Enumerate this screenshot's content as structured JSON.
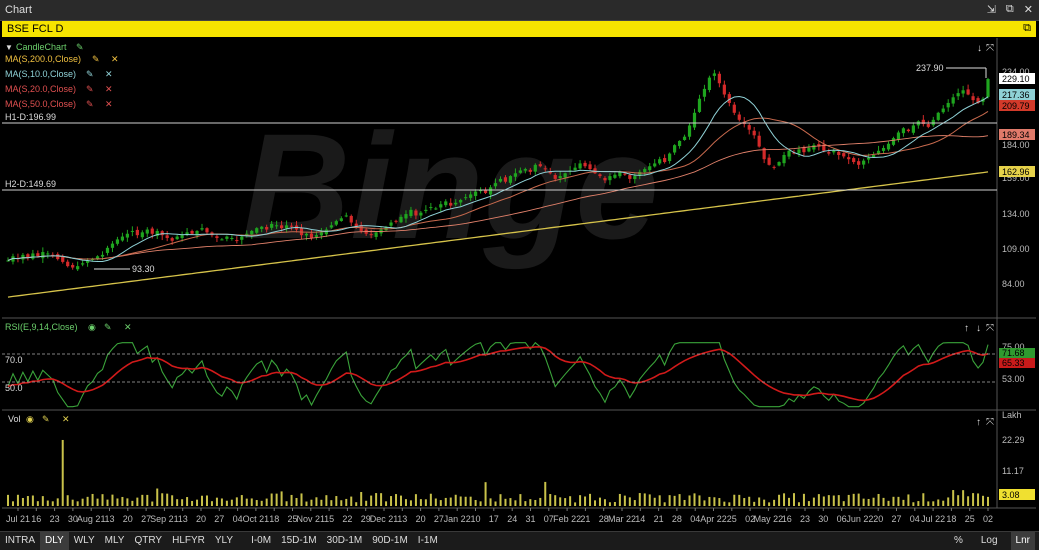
{
  "window": {
    "title": "Chart",
    "controls": [
      "⇲",
      "⧉",
      "✕"
    ]
  },
  "symbol_bar": {
    "label": "BSE FCL D",
    "restore_icon": "⧉"
  },
  "legend": {
    "candle": "CandleChart",
    "ma200": "MA(S,200.0,Close)",
    "ma10": "MA(S,10.0,Close)",
    "ma20": "MA(S,20.0,Close)",
    "ma50": "MA(S,50.0,Close)",
    "rsi": "RSI(E,9,14,Close)",
    "vol": "Vol"
  },
  "colors": {
    "bull": "#1fa51f",
    "bear": "#d42a2a",
    "ma200": "#d6c34a",
    "ma10": "#8fd1d6",
    "ma20": "#c96a4e",
    "ma50": "#e0806a",
    "rsi": "#3aa33a",
    "rsi_signal": "#d11a1a",
    "vol": "#c9c24a",
    "hline": "#d0d0d0"
  },
  "chart_data": [
    {
      "type": "candlestick",
      "title": "BSE FCL D",
      "x_labels": [
        "Jul 21",
        "16",
        "23",
        "30",
        "Aug 21",
        "13",
        "20",
        "27",
        "Sep 21",
        "13",
        "20",
        "27",
        "04",
        "Oct 21",
        "18",
        "25",
        "Nov 21",
        "15",
        "22",
        "29",
        "Dec 21",
        "13",
        "20",
        "27",
        "Jan 22",
        "10",
        "17",
        "24",
        "31",
        "07",
        "Feb 22",
        "21",
        "28",
        "Mar 22",
        "14",
        "21",
        "28",
        "04",
        "Apr 22",
        "25",
        "02",
        "May 22",
        "16",
        "23",
        "30",
        "06",
        "Jun 22",
        "20",
        "27",
        "04",
        "Jul 22",
        "18",
        "25",
        "02"
      ],
      "y_ticks": [
        84.0,
        109.0,
        134.0,
        159.0,
        184.0,
        234.0
      ],
      "ylim": [
        70,
        245
      ],
      "closes": [
        100,
        103,
        101,
        104,
        102,
        105,
        103,
        106,
        105,
        104,
        101,
        99,
        96,
        95,
        96,
        98,
        100,
        101,
        103,
        104,
        109,
        112,
        115,
        117,
        119,
        121,
        118,
        120,
        122,
        119,
        121,
        118,
        116,
        114,
        117,
        118,
        120,
        119,
        121,
        123,
        120,
        118,
        116,
        115,
        117,
        116,
        114,
        117,
        119,
        121,
        123,
        124,
        122,
        126,
        125,
        123,
        125,
        124,
        122,
        118,
        119,
        116,
        118,
        120,
        122,
        125,
        128,
        130,
        132,
        127,
        124,
        121,
        119,
        118,
        120,
        122,
        124,
        127,
        128,
        131,
        133,
        136,
        132,
        134,
        136,
        138,
        137,
        140,
        142,
        139,
        141,
        143,
        145,
        147,
        149,
        150,
        148,
        152,
        155,
        158,
        156,
        160,
        162,
        164,
        165,
        163,
        168,
        167,
        165,
        162,
        158,
        160,
        162,
        164,
        166,
        169,
        167,
        165,
        162,
        160,
        157,
        160,
        161,
        163,
        161,
        158,
        160,
        163,
        165,
        167,
        169,
        172,
        170,
        176,
        182,
        185,
        188,
        196,
        205,
        215,
        222,
        230,
        233,
        226,
        218,
        212,
        205,
        200,
        197,
        193,
        189,
        181,
        172,
        168,
        166,
        170,
        175,
        178,
        176,
        179,
        177,
        180,
        182,
        181,
        178,
        176,
        178,
        175,
        174,
        172,
        170,
        168,
        171,
        173,
        175,
        178,
        180,
        183,
        187,
        191,
        194,
        192,
        196,
        199,
        197,
        195,
        200,
        205,
        208,
        212,
        216,
        219,
        221,
        218,
        214,
        212,
        215,
        229
      ],
      "series": [
        {
          "name": "MA(S,10.0,Close)",
          "value_last": 217.36
        },
        {
          "name": "MA(S,20.0,Close)",
          "value_last": 209.79
        },
        {
          "name": "MA(S,50.0,Close)",
          "value_last": 189.34
        },
        {
          "name": "MA(S,200.0,Close)",
          "value_last": 162.96
        }
      ],
      "last_close": 229.1,
      "annotations": [
        {
          "text": "237.90",
          "value": 237.9
        },
        {
          "text": "93.30",
          "value": 93.3
        }
      ],
      "hlines": [
        {
          "text": "H1-D:196.99",
          "value": 196.99
        },
        {
          "text": "H2-D:149.69",
          "value": 149.69
        }
      ],
      "price_labels": {
        "last": "229.10",
        "ma10": "217.36",
        "ma20": "209.79",
        "ma50": "189.34",
        "ma200": "162.96",
        "t234": "234.00",
        "t184": "184.00",
        "t159": "159.00",
        "t134": "134.00",
        "t109": "109.00",
        "t84": "84.00",
        "hi": "237.90",
        "lo": "93.30"
      }
    },
    {
      "type": "line",
      "title": "RSI(E,9,14,Close)",
      "y_ticks": [
        53.0,
        75.0
      ],
      "ylim": [
        40,
        85
      ],
      "levels": [
        {
          "text": "70.0",
          "value": 70
        },
        {
          "text": "50.0",
          "value": 50
        }
      ],
      "last_rsi": "71.68",
      "last_signal": "65.33",
      "t75": "75.00",
      "t53": "53.00"
    },
    {
      "type": "bar",
      "title": "Vol",
      "unit": "Lakh",
      "y_ticks": [
        11.17,
        22.29
      ],
      "t22": "22.29",
      "t11": "11.17",
      "last_vol": "3.08",
      "spike_max": 22.3
    }
  ],
  "timeframes": [
    "INTRA",
    "DLY",
    "WLY",
    "MLY",
    "QTRY",
    "HLFYR",
    "YLY"
  ],
  "timeframe_active": "DLY",
  "ranges": [
    "I-0M",
    "15D-1M",
    "30D-1M",
    "90D-1M",
    "I-1M"
  ],
  "bottom_right": {
    "pct": "%",
    "log": "Log",
    "lnr": "Lnr"
  },
  "watermark": "Binge"
}
